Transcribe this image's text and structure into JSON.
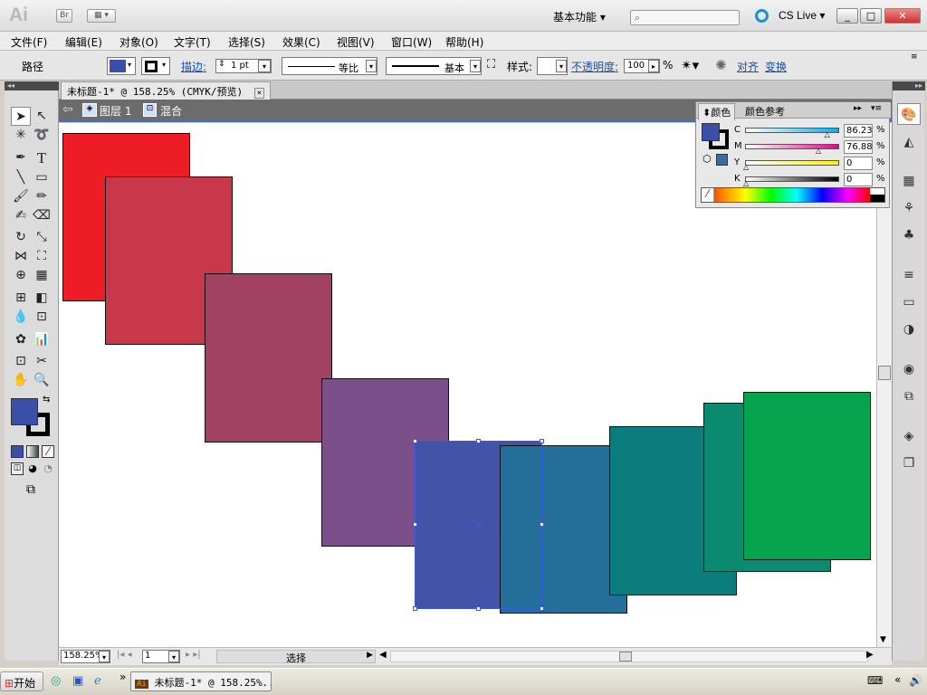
{
  "app": {
    "logo": "Ai",
    "bridge_label": "Br",
    "workspace": "基本功能",
    "cs_live": "CS Live",
    "window_buttons": [
      "_",
      "□",
      "✕"
    ]
  },
  "menus": [
    "文件(F)",
    "编辑(E)",
    "对象(O)",
    "文字(T)",
    "选择(S)",
    "效果(C)",
    "视图(V)",
    "窗口(W)",
    "帮助(H)"
  ],
  "control": {
    "object_type": "路径",
    "stroke_label": "描边:",
    "stroke_weight": "1 pt",
    "stroke_profile": "等比",
    "brush": "基本",
    "style_label": "样式:",
    "opacity_label": "不透明度:",
    "opacity_value": "100",
    "percent": "%",
    "align_label": "对齐",
    "transform_label": "变换"
  },
  "document": {
    "tab_title": "未标题-1* @ 158.25% (CMYK/预览)",
    "layer": "图层 1",
    "blend": "混合"
  },
  "color_panel": {
    "tab_color": "颜色",
    "tab_guide": "颜色参考",
    "channels": [
      {
        "key": "C",
        "value": "86.23",
        "pct": 86.23,
        "color": "#00aeef"
      },
      {
        "key": "M",
        "value": "76.88",
        "pct": 76.88,
        "color": "#ec008c"
      },
      {
        "key": "Y",
        "value": "0",
        "pct": 0,
        "color": "#fff200"
      },
      {
        "key": "K",
        "value": "0",
        "pct": 0,
        "color": "#000000"
      }
    ],
    "percent": "%",
    "fill_color": "#3b4fa8"
  },
  "artwork": {
    "squares": [
      "#ee1c25",
      "#c8374a",
      "#a24262",
      "#7b4f8a",
      "#4354a8",
      "#236f9a",
      "#0b7d7d",
      "#0a8a6f",
      "#06a44f"
    ],
    "selected_index": 4
  },
  "status": {
    "zoom": "158.25%",
    "page": "1",
    "tool_name": "选择"
  },
  "taskbar": {
    "start": "开始",
    "task": "未标题-1* @ 158.25%..."
  }
}
